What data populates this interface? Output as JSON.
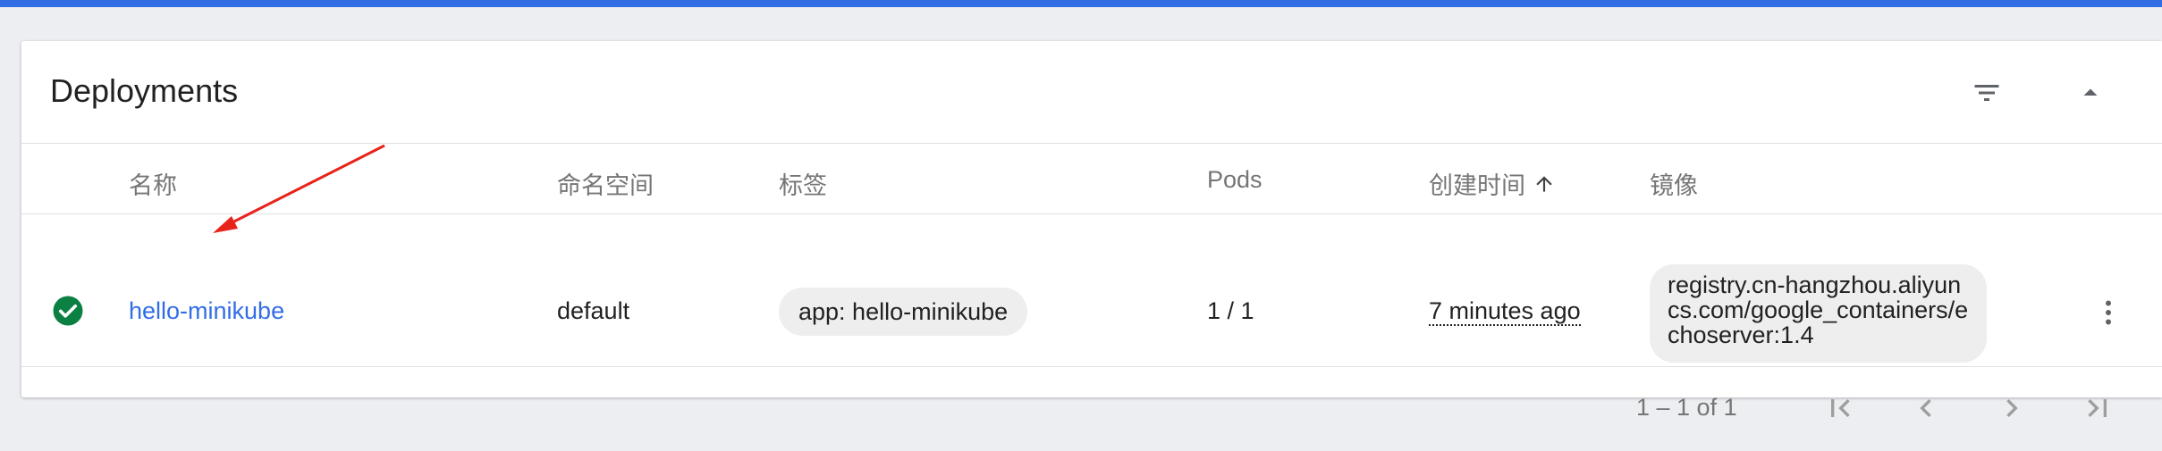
{
  "card": {
    "title": "Deployments",
    "actions": {
      "filter_icon": "filter-list-icon",
      "collapse_icon": "arrow-drop-up-icon"
    }
  },
  "table": {
    "headers": {
      "name": "名称",
      "namespace": "命名空间",
      "labels": "标签",
      "pods": "Pods",
      "created": "创建时间",
      "images": "镜像"
    },
    "sort": {
      "column": "created",
      "direction": "ascending",
      "icon": "arrow-upward-icon"
    },
    "rows": [
      {
        "status": "running",
        "status_icon": "check-circle-icon",
        "status_color": "#0b8043",
        "name": "hello-minikube",
        "namespace": "default",
        "label": "app: hello-minikube",
        "pods": "1 / 1",
        "created": "7 minutes ago",
        "image": "registry.cn-hangzhou.aliyuncs.com/google_containers/echoserver:1.4",
        "menu_icon": "more-vert-icon"
      }
    ]
  },
  "pagination": {
    "range": "1 – 1 of 1",
    "buttons": [
      "first-page-icon",
      "chevron-left-icon",
      "chevron-right-icon",
      "last-page-icon"
    ]
  },
  "colors": {
    "accent": "#326de6",
    "link": "#326de6",
    "annotation_arrow": "#e8231c",
    "background": "#eceef1"
  }
}
